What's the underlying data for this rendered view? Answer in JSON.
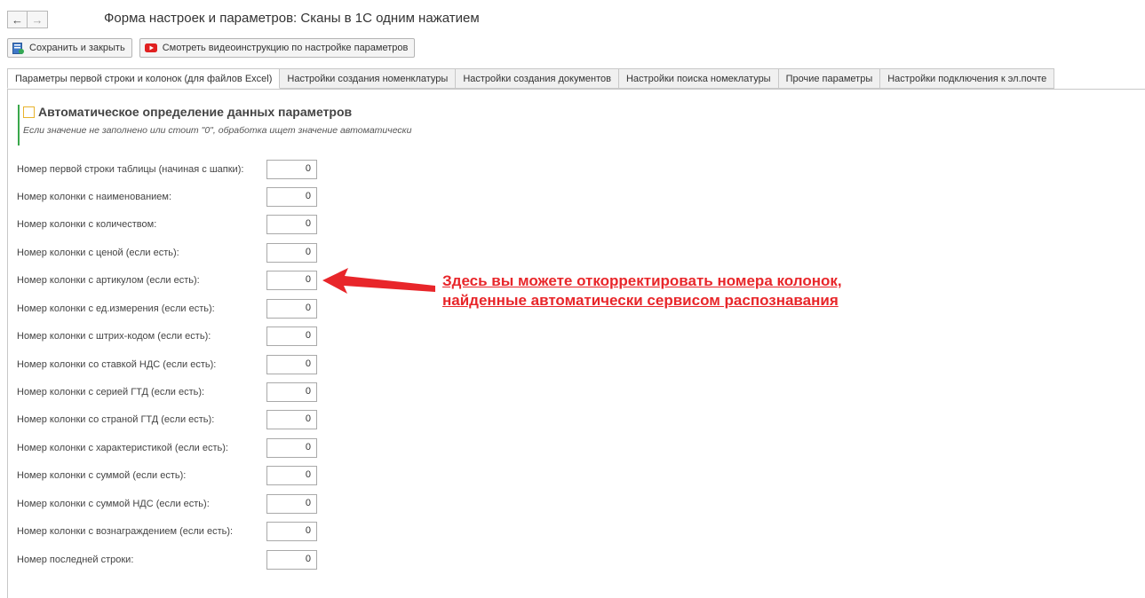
{
  "nav": {
    "back": "←",
    "forward": "→"
  },
  "window": {
    "title": "Форма настроек и параметров: Сканы в 1С одним нажатием"
  },
  "toolbar": {
    "save_close_label": "Сохранить и закрыть",
    "video_label": "Смотреть видеоинструкцию по настройке параметров"
  },
  "tabs": [
    {
      "label": "Параметры первой строки и колонок (для файлов Excel)"
    },
    {
      "label": "Настройки создания номенклатуры"
    },
    {
      "label": "Настройки создания документов"
    },
    {
      "label": "Настройки поиска номеклатуры"
    },
    {
      "label": "Прочие параметры"
    },
    {
      "label": "Настройки подключения к эл.почте"
    }
  ],
  "group": {
    "checkbox_label": "Автоматическое определение данных параметров",
    "checked": false,
    "note": "Если значение не заполнено или стоит \"0\",  обработка ищет значение автоматически"
  },
  "fields": [
    {
      "label": "Номер первой строки таблицы (начиная с шапки):",
      "value": "0"
    },
    {
      "label": "Номер колонки с наименованием:",
      "value": "0"
    },
    {
      "label": "Номер колонки с количеством:",
      "value": "0"
    },
    {
      "label": "Номер колонки с ценой (если есть):",
      "value": "0"
    },
    {
      "label": "Номер колонки с артикулом (если есть):",
      "value": "0"
    },
    {
      "label": "Номер колонки с ед.измерения (если есть):",
      "value": "0"
    },
    {
      "label": "Номер колонки с штрих-кодом (если есть):",
      "value": "0"
    },
    {
      "label": "Номер колонки со ставкой НДС (если есть):",
      "value": "0"
    },
    {
      "label": "Номер колонки с серией ГТД (если есть):",
      "value": "0"
    },
    {
      "label": "Номер колонки со страной ГТД (если есть):",
      "value": "0"
    },
    {
      "label": "Номер колонки с характеристикой (если есть):",
      "value": "0"
    },
    {
      "label": "Номер колонки с суммой (если есть):",
      "value": "0"
    },
    {
      "label": "Номер колонки с суммой НДС (если есть):",
      "value": "0"
    },
    {
      "label": "Номер колонки с вознаграждением (если есть):",
      "value": "0"
    },
    {
      "label": "Номер последней строки:",
      "value": "0"
    }
  ],
  "callout": {
    "line1": "Здесь вы можете откорректировать номера колонок,",
    "line2": "найденные автоматически сервисом распознавания",
    "color": "#e8262a"
  },
  "colors": {
    "accent_green": "#3aa84b",
    "checkbox_border": "#e8b32c",
    "video_icon": "#e02020"
  }
}
